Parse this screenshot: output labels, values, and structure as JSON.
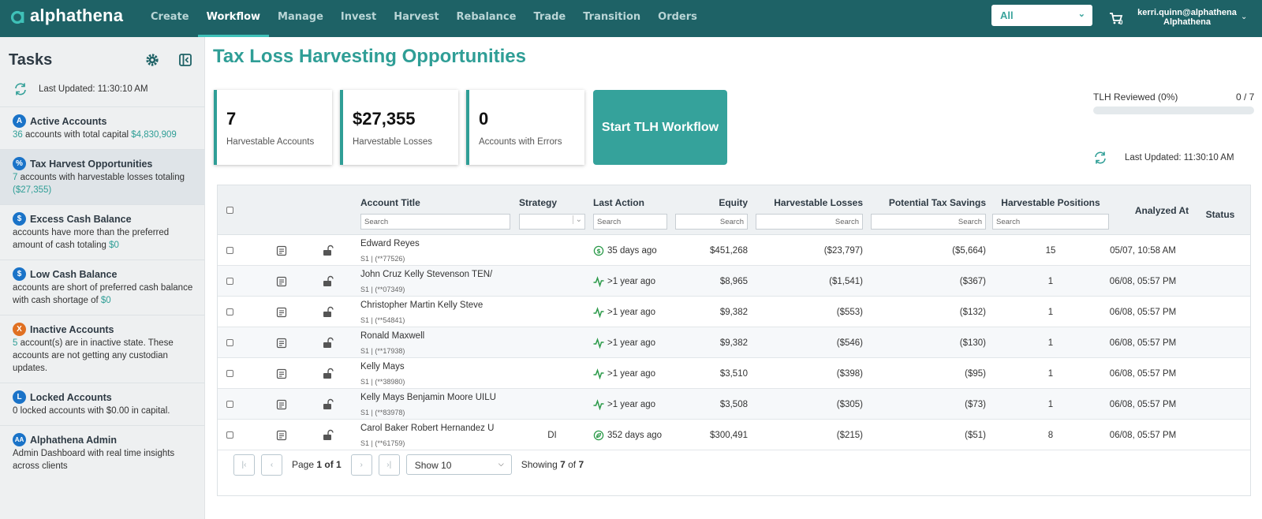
{
  "app": {
    "logo_text": "alphathena",
    "nav": [
      "Create",
      "Workflow",
      "Manage",
      "Invest",
      "Harvest",
      "Rebalance",
      "Trade",
      "Transition",
      "Orders"
    ],
    "active_nav": "Workflow",
    "select_value": "All",
    "cart_count": "0",
    "user_email": "kerri.quinn@alphathena",
    "user_org": "Alphathena"
  },
  "sidebar": {
    "title": "Tasks",
    "last_updated": "Last Updated: 11:30:10 AM",
    "tasks": [
      {
        "badge": "A",
        "title": "Active Accounts",
        "desc": [
          {
            "t": "36",
            "c": "teal"
          },
          {
            "t": " accounts with total capital "
          },
          {
            "t": "$4,830,909",
            "c": "teal"
          }
        ]
      },
      {
        "badge": "%",
        "title": "Tax Harvest Opportunities",
        "desc": [
          {
            "t": "7",
            "c": "teal"
          },
          {
            "t": " accounts with harvestable losses totaling "
          },
          {
            "t": "($27,355)",
            "c": "teal"
          }
        ]
      },
      {
        "badge": "$",
        "title": "Excess Cash Balance",
        "desc": [
          {
            "t": "accounts have more than the preferred amount of cash totaling "
          },
          {
            "t": "$0",
            "c": "teal"
          }
        ]
      },
      {
        "badge": "$",
        "title": "Low Cash Balance",
        "desc": [
          {
            "t": "accounts are short of preferred cash balance with cash shortage of "
          },
          {
            "t": "$0",
            "c": "teal"
          }
        ]
      },
      {
        "badge": "X",
        "badge_color": "orange",
        "title": "Inactive Accounts",
        "desc": [
          {
            "t": "5",
            "c": "teal"
          },
          {
            "t": " account(s) are in inactive state. These accounts are not getting any custodian updates."
          }
        ]
      },
      {
        "badge": "L",
        "title": "Locked Accounts",
        "desc": [
          {
            "t": "0 locked accounts with $0.00 in capital."
          }
        ]
      },
      {
        "badge": "AA",
        "title": "Alphathena Admin",
        "desc": [
          {
            "t": "Admin Dashboard with real time insights across clients"
          }
        ]
      }
    ]
  },
  "main": {
    "title": "Tax Loss Harvesting Opportunities",
    "cards": [
      {
        "value": "7",
        "label": "Harvestable Accounts"
      },
      {
        "value": "$27,355",
        "label": "Harvestable Losses"
      },
      {
        "value": "0",
        "label": "Accounts with Errors"
      }
    ],
    "start_button": "Start TLH Workflow",
    "review_label": "TLH Reviewed (0%)",
    "review_count": "0 / 7",
    "review_fraction": 0,
    "last_updated": "Last Updated: 11:30:10 AM"
  },
  "table": {
    "headers": {
      "account_title": "Account Title",
      "strategy": "Strategy",
      "last_action": "Last Action",
      "equity": "Equity",
      "harvestable_losses": "Harvestable Losses",
      "potential_tax_savings": "Potential Tax Savings",
      "harvestable_positions": "Harvestable Positions",
      "analyzed_at": "Analyzed At",
      "status": "Status"
    },
    "filter_placeholder": "Search",
    "rows": [
      {
        "name": "Edward Reyes",
        "sub": "S1 | (**77526)",
        "strategy": "",
        "action_icon": "dollar-circle-icon",
        "last_action": "35 days ago",
        "equity": "$451,268",
        "losses": "($23,797)",
        "savings": "($5,664)",
        "positions": "15",
        "analyzed": "05/07, 10:58 AM",
        "status": ""
      },
      {
        "name": "John Cruz Kelly Stevenson TEN/",
        "sub": "S1 | (**07349)",
        "strategy": "",
        "action_icon": "activity-icon",
        "last_action": ">1 year ago",
        "equity": "$8,965",
        "losses": "($1,541)",
        "savings": "($367)",
        "positions": "1",
        "analyzed": "06/08, 05:57 PM",
        "status": ""
      },
      {
        "name": "Christopher Martin Kelly Steve",
        "sub": "S1 | (**54841)",
        "strategy": "",
        "action_icon": "activity-icon",
        "last_action": ">1 year ago",
        "equity": "$9,382",
        "losses": "($553)",
        "savings": "($132)",
        "positions": "1",
        "analyzed": "06/08, 05:57 PM",
        "status": ""
      },
      {
        "name": "Ronald Maxwell",
        "sub": "S1 | (**17938)",
        "strategy": "",
        "action_icon": "activity-icon",
        "last_action": ">1 year ago",
        "equity": "$9,382",
        "losses": "($546)",
        "savings": "($130)",
        "positions": "1",
        "analyzed": "06/08, 05:57 PM",
        "status": ""
      },
      {
        "name": "Kelly Mays",
        "sub": "S1 | (**38980)",
        "strategy": "",
        "action_icon": "activity-icon",
        "last_action": ">1 year ago",
        "equity": "$3,510",
        "losses": "($398)",
        "savings": "($95)",
        "positions": "1",
        "analyzed": "06/08, 05:57 PM",
        "status": ""
      },
      {
        "name": "Kelly Mays Benjamin Moore UILU",
        "sub": "S1 | (**83978)",
        "strategy": "",
        "action_icon": "activity-icon",
        "last_action": ">1 year ago",
        "equity": "$3,508",
        "losses": "($305)",
        "savings": "($73)",
        "positions": "1",
        "analyzed": "06/08, 05:57 PM",
        "status": ""
      },
      {
        "name": "Carol Baker Robert Hernandez U",
        "sub": "S1 | (**61759)",
        "strategy": "DI",
        "action_icon": "leaf-circle-icon",
        "last_action": "352 days ago",
        "equity": "$300,491",
        "losses": "($215)",
        "savings": "($51)",
        "positions": "8",
        "analyzed": "06/08, 05:57 PM",
        "status": ""
      }
    ],
    "pager": {
      "page_label": "Page",
      "page_value": "1 of 1",
      "show_value": "Show 10",
      "showing_prefix": "Showing",
      "showing_count": "7",
      "showing_of": "of",
      "showing_total": "7"
    }
  },
  "colors": {
    "nav_bg": "#1e6266",
    "accent": "#2f9e96",
    "badge_blue": "#1a73c8",
    "badge_orange": "#e07022"
  }
}
